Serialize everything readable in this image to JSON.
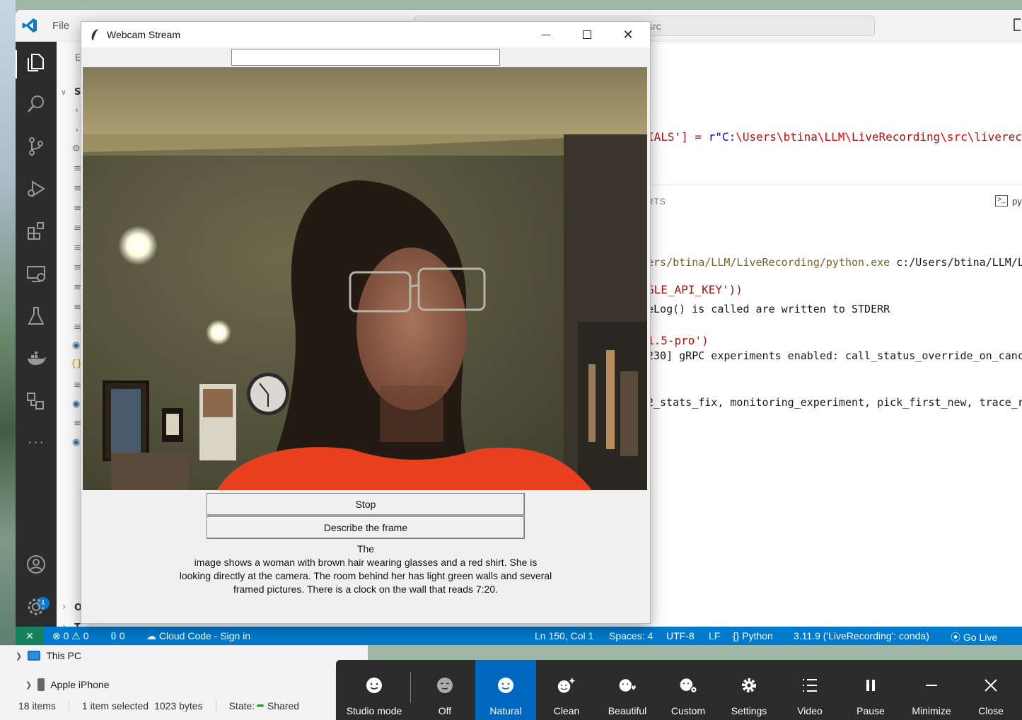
{
  "vscode": {
    "menu_file": "File",
    "search_text": "src",
    "sidebar_letters": [
      "E",
      "S",
      "O",
      "T"
    ],
    "code_lines": [
      {
        "a": "IALS'] = ",
        "b": "r\"C:",
        "c": "\\U",
        "d": "sers",
        "e": "\\b",
        "f": "tina",
        "g": "\\LLM\\",
        "h": "LiveRecording",
        "i": "\\src\\",
        "j": "livereco"
      },
      {
        "text": "GLE_API_KEY'))"
      },
      {
        "text": "1.5-pro')"
      }
    ],
    "panel_label": "RTS",
    "panel_py": "py",
    "terminal_lines": [
      {
        "path": "ers/btina/LLM/LiveRecording/python.exe",
        "rest": " c:/Users/btina/LLM/L"
      },
      {
        "path": "",
        "rest": "eLog() is called are written to STDERR"
      },
      {
        "path": "",
        "rest": "230] gRPC experiments enabled: call_status_override_on_canc"
      },
      {
        "path": "",
        "rest": "2_stats_fix, monitoring_experiment, pick_first_new, trace_r"
      }
    ],
    "status": {
      "errors": "0",
      "warnings": "0",
      "ports": "0",
      "cloud_code": "Cloud Code - Sign in",
      "position": "Ln 150, Col 1",
      "spaces": "Spaces: 4",
      "encoding": "UTF-8",
      "eol": "LF",
      "language": "Python",
      "interpreter": "3.11.9 ('LiveRecording': conda)",
      "go_live": "Go Live"
    },
    "accounts_badge": "1",
    "colors": {
      "statusbar": "#007acc",
      "activity": "#2c2c2c"
    }
  },
  "webcam": {
    "title": "Webcam Stream",
    "entry_value": "",
    "stop_label": "Stop",
    "describe_label": "Describe the frame",
    "description": "The\nimage shows a woman with brown hair wearing glasses and a red shirt. She is\nlooking directly at the camera. The room behind her has light green walls and several\nframed pictures. There is a clock on the wall that reads 7:20."
  },
  "explorer": {
    "this_pc": "This PC",
    "apple_iphone": "Apple iPhone",
    "item_count": "18 items",
    "selected": "1 item selected",
    "size": "1023 bytes",
    "state_label": "State:",
    "state_value": "Shared"
  },
  "studio": {
    "buttons": [
      {
        "label": "Studio mode",
        "icon": "face-icon"
      },
      {
        "label": "Off",
        "icon": "face-off-icon"
      },
      {
        "label": "Natural",
        "icon": "face-natural-icon",
        "active": true
      },
      {
        "label": "Clean",
        "icon": "face-sparkle-icon"
      },
      {
        "label": "Beautiful",
        "icon": "face-heart-icon"
      },
      {
        "label": "Custom",
        "icon": "face-gear-icon"
      },
      {
        "label": "Settings",
        "icon": "gear-icon"
      },
      {
        "label": "Video",
        "icon": "list-icon"
      },
      {
        "label": "Pause",
        "icon": "pause-icon"
      },
      {
        "label": "Minimize",
        "icon": "minus-icon"
      },
      {
        "label": "Close",
        "icon": "close-icon"
      }
    ],
    "active_color": "#0067c0"
  }
}
